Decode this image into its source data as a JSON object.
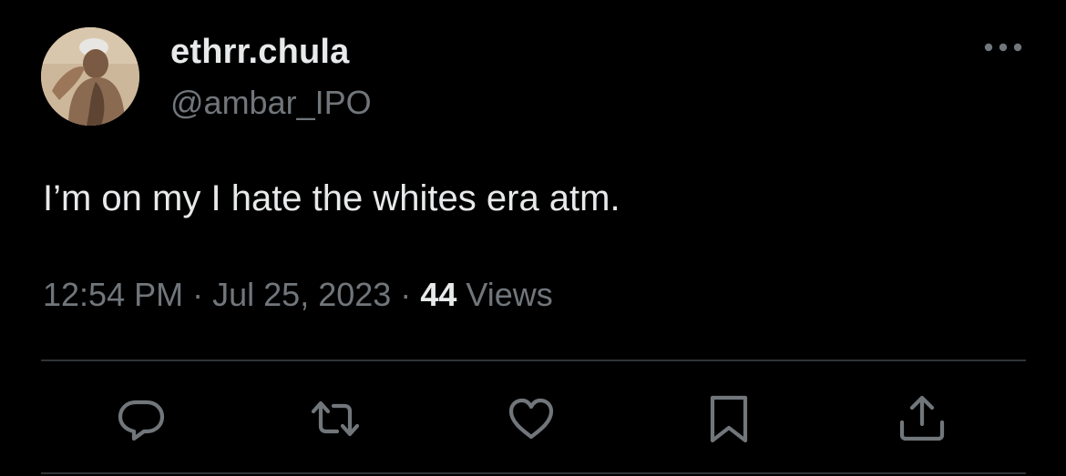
{
  "tweet": {
    "author": {
      "display_name": "ethrr.chula",
      "handle": "@ambar_IPO",
      "avatar_icon": "profile-photo"
    },
    "text": "I’m on my I hate the whites era atm.",
    "time": "12:54 PM",
    "date": "Jul 25, 2023",
    "separator": "·",
    "views_count": "44",
    "views_label": "Views",
    "more_icon": "ellipsis-icon"
  },
  "actions": [
    {
      "name": "reply",
      "icon": "speech-bubble-icon"
    },
    {
      "name": "retweet",
      "icon": "retweet-arrows-icon"
    },
    {
      "name": "like",
      "icon": "heart-icon"
    },
    {
      "name": "bookmark",
      "icon": "bookmark-icon"
    },
    {
      "name": "share",
      "icon": "share-upload-icon"
    }
  ],
  "colors": {
    "background": "#000000",
    "primary_text": "#e7e9ea",
    "secondary_text": "#71767b",
    "divider": "#2f3336",
    "icon": "#71767b"
  }
}
